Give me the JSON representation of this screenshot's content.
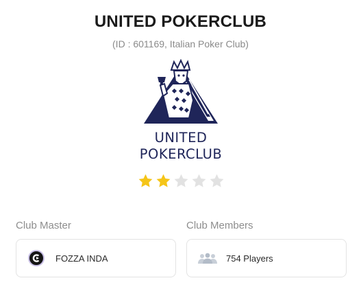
{
  "club": {
    "name": "UNITED POKERCLUB",
    "subtitle": "(ID : 601169, Italian Poker Club)",
    "logo": {
      "line1": "UNITED",
      "line2": "POKERCLUB",
      "icon": "king-of-spades-logo"
    },
    "rating": {
      "value": 2,
      "max": 5,
      "filled_color": "#F5C518",
      "empty_color": "#E2E2E2"
    }
  },
  "master": {
    "label": "Club Master",
    "name": "FOZZA INDA",
    "avatar_icon": "user-avatar-icon"
  },
  "members": {
    "label": "Club Members",
    "count_text": "754 Players",
    "icon": "people-group-icon"
  },
  "colors": {
    "logo_navy": "#1F2559",
    "label_gray": "#8D8D8D"
  }
}
